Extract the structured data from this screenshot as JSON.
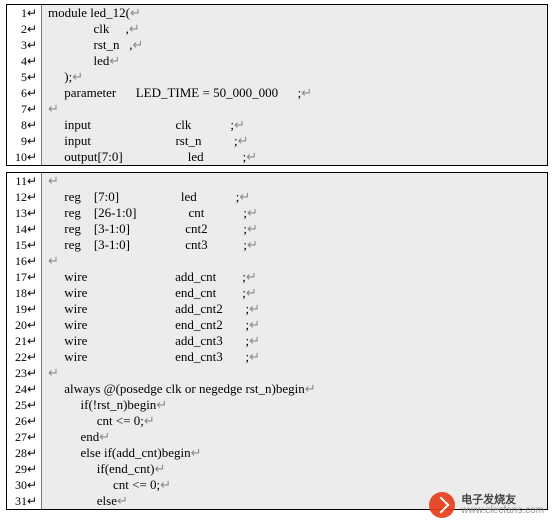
{
  "block1": {
    "lines": [
      {
        "n": "1",
        "text": "module led_12("
      },
      {
        "n": "2",
        "text": "              clk     ,"
      },
      {
        "n": "3",
        "text": "              rst_n   ,"
      },
      {
        "n": "4",
        "text": "              led"
      },
      {
        "n": "5",
        "text": "     );"
      },
      {
        "n": "6",
        "text": "     parameter      LED_TIME = 50_000_000      ;"
      },
      {
        "n": "7",
        "text": ""
      },
      {
        "n": "8",
        "text": "     input                          clk            ;"
      },
      {
        "n": "9",
        "text": "     input                          rst_n          ;"
      },
      {
        "n": "10",
        "text": "     output[7:0]                    led            ;"
      }
    ]
  },
  "block2": {
    "lines": [
      {
        "n": "11",
        "text": ""
      },
      {
        "n": "12",
        "text": "     reg    [7:0]                   led            ;"
      },
      {
        "n": "13",
        "text": "     reg    [26-1:0]                cnt            ;"
      },
      {
        "n": "14",
        "text": "     reg    [3-1:0]                 cnt2           ;"
      },
      {
        "n": "15",
        "text": "     reg    [3-1:0]                 cnt3           ;"
      },
      {
        "n": "16",
        "text": ""
      },
      {
        "n": "17",
        "text": "     wire                           add_cnt        ;"
      },
      {
        "n": "18",
        "text": "     wire                           end_cnt        ;"
      },
      {
        "n": "19",
        "text": "     wire                           add_cnt2       ;"
      },
      {
        "n": "20",
        "text": "     wire                           end_cnt2       ;"
      },
      {
        "n": "21",
        "text": "     wire                           add_cnt3       ;"
      },
      {
        "n": "22",
        "text": "     wire                           end_cnt3       ;"
      },
      {
        "n": "23",
        "text": ""
      },
      {
        "n": "24",
        "text": "     always @(posedge clk or negedge rst_n)begin"
      },
      {
        "n": "25",
        "text": "          if(!rst_n)begin"
      },
      {
        "n": "26",
        "text": "               cnt <= 0;"
      },
      {
        "n": "27",
        "text": "          end"
      },
      {
        "n": "28",
        "text": "          else if(add_cnt)begin"
      },
      {
        "n": "29",
        "text": "               if(end_cnt)"
      },
      {
        "n": "30",
        "text": "                    cnt <= 0;"
      },
      {
        "n": "31",
        "text": "               else"
      }
    ]
  },
  "cr_symbol": "↵",
  "watermark": {
    "cn": "电子发烧友",
    "url": "www.elecfans.com"
  }
}
